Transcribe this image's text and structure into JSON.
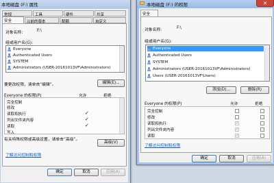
{
  "colors": {
    "desktop": "#cfd8e3",
    "close_button": "#c7473a",
    "selection": "#3399ff",
    "link": "#0a5bc4"
  },
  "left_window": {
    "title": "本地磁盘 (F:) 属性",
    "tabs_row1": [
      "常规",
      "工具",
      "硬件",
      "共享"
    ],
    "tabs_row2": [
      "安全",
      "以前的版本",
      "配额",
      "自定义"
    ],
    "object_name_label": "对象名称:",
    "object_name_value": "F:\\",
    "group_label": "组或用户名(G):",
    "users": [
      "Everyone",
      "Authenticated Users",
      "SYSTEM",
      "Administrators (USER-20161013VF\\Administrators)"
    ],
    "change_hint": "要更改权限，请单击“编辑”。",
    "edit_button": "编辑(E)...",
    "perm_header": "Everyone 的权限(P)",
    "allow_header": "允许",
    "deny_header": "拒绝",
    "permissions": [
      {
        "name": "完全控制",
        "allow": false
      },
      {
        "name": "修改",
        "allow": false
      },
      {
        "name": "读取和执行",
        "allow": true
      },
      {
        "name": "列出文件夹内容",
        "allow": true
      },
      {
        "name": "读取",
        "allow": true
      },
      {
        "name": "写入",
        "allow": false
      }
    ],
    "advanced_hint": "有关特殊权限或高级设置，请单击“高级”。",
    "advanced_button": "高级(V)",
    "link": "了解访问控制和权限",
    "ok": "确定",
    "cancel": "取消",
    "apply": "应用(A)"
  },
  "right_window": {
    "title": "本地磁盘 (F:) 的权限",
    "tab": "安全",
    "object_name_label": "对象名称:",
    "object_name_value": "F:\\",
    "group_label": "组或用户名(G):",
    "users": [
      "Everyone",
      "Authenticated Users",
      "SYSTEM",
      "Administrators (USER-20161013VF\\Administrators)",
      "Users (USER-20161013VF\\Users)"
    ],
    "selected_user": "Everyone",
    "add_button": "添加(D)...",
    "remove_button": "删除(R)",
    "perm_header": "Everyone 的权限(P)",
    "allow_header": "允许",
    "deny_header": "拒绝",
    "permissions": [
      {
        "name": "完全控制",
        "allow": false,
        "deny": false
      },
      {
        "name": "修改",
        "allow": false,
        "deny": false
      },
      {
        "name": "读取和执行",
        "allow": true,
        "deny": false
      },
      {
        "name": "列出文件夹内容",
        "allow": true,
        "deny": false
      },
      {
        "name": "读取",
        "allow": true,
        "deny": false
      }
    ],
    "link": "了解访问控制和权限",
    "ok": "确定",
    "cancel": "取消",
    "apply": "应用(A)"
  }
}
